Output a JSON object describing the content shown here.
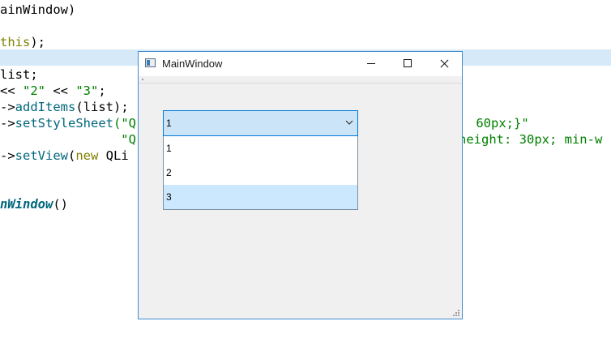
{
  "editor": {
    "lines": [
      [
        {
          "t": "ainWindow)",
          "c": "pl"
        }
      ],
      [
        {
          "t": "this",
          "c": "kw"
        },
        {
          "t": ");",
          "c": "pl"
        }
      ],
      [
        {
          "t": "list;",
          "c": "pl"
        }
      ],
      [
        {
          "t": "<< ",
          "c": "pl"
        },
        {
          "t": "\"2\"",
          "c": "str"
        },
        {
          "t": " << ",
          "c": "pl"
        },
        {
          "t": "\"3\"",
          "c": "str"
        },
        {
          "t": ";",
          "c": "pl"
        }
      ],
      [
        {
          "t": "->",
          "c": "pl"
        },
        {
          "t": "addItems",
          "c": "fn"
        },
        {
          "t": "(list);",
          "c": "pl"
        }
      ],
      [
        {
          "t": "->",
          "c": "pl"
        },
        {
          "t": "setStyleSheet",
          "c": "fn"
        },
        {
          "t": "(\"Q",
          "c": "str"
        }
      ],
      [
        {
          "t": "                \"Q",
          "c": "str"
        }
      ],
      [
        {
          "t": "->",
          "c": "pl"
        },
        {
          "t": "setView",
          "c": "fn"
        },
        {
          "t": "(",
          "c": "pl"
        },
        {
          "t": "new",
          "c": "kw"
        },
        {
          "t": " QLi",
          "c": "pl"
        }
      ],
      [
        {
          "t": "nWindow",
          "c": "it"
        },
        {
          "t": "()",
          "c": "pl"
        }
      ]
    ],
    "right_fragments": [
      " 60px;}\"",
      "height: 30px; min-w"
    ]
  },
  "window": {
    "title": "MainWindow",
    "combo": {
      "current": "1",
      "items": [
        {
          "label": "1",
          "selected": false
        },
        {
          "label": "2",
          "selected": false
        },
        {
          "label": "3",
          "selected": true
        }
      ]
    }
  }
}
